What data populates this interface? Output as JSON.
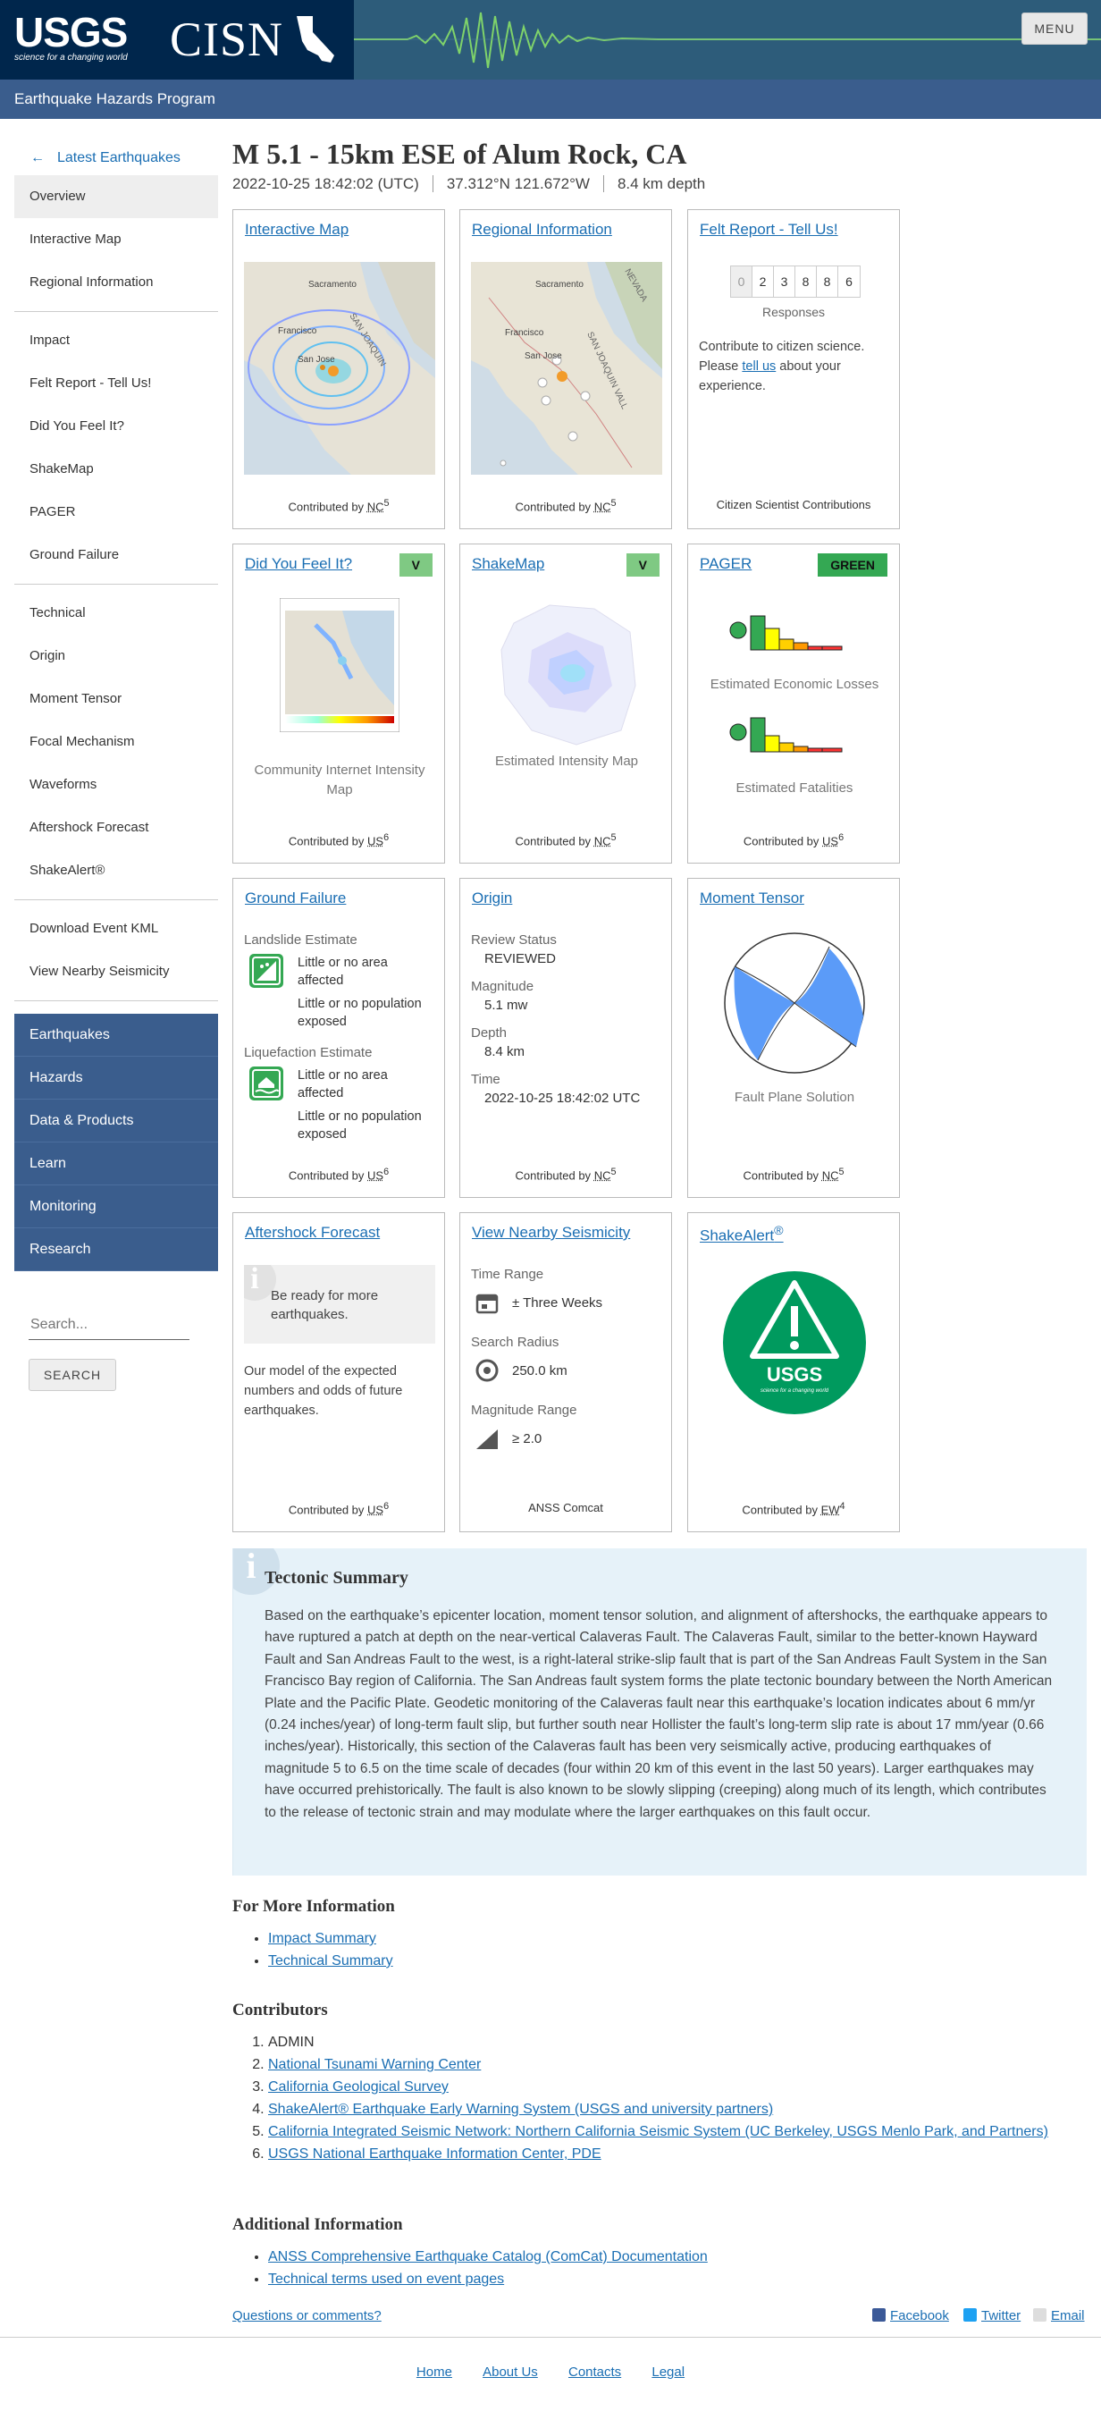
{
  "header": {
    "usgs_logo": "USGS",
    "usgs_tagline": "science for a changing world",
    "cisn_logo": "CISN",
    "menu_label": "MENU",
    "program": "Earthquake Hazards Program"
  },
  "sidebar": {
    "back_label": "Latest Earthquakes",
    "group1": [
      "Overview",
      "Interactive Map",
      "Regional Information"
    ],
    "group2": [
      "Impact",
      "Felt Report - Tell Us!",
      "Did You Feel It?",
      "ShakeMap",
      "PAGER",
      "Ground Failure"
    ],
    "group3": [
      "Technical",
      "Origin",
      "Moment Tensor",
      "Focal Mechanism",
      "Waveforms",
      "Aftershock Forecast",
      "ShakeAlert®"
    ],
    "group4": [
      "Download Event KML",
      "View Nearby Seismicity"
    ],
    "blue": [
      "Earthquakes",
      "Hazards",
      "Data & Products",
      "Learn",
      "Monitoring",
      "Research"
    ],
    "search_placeholder": "Search...",
    "search_button": "SEARCH"
  },
  "event": {
    "title": "M 5.1 - 15km ESE of Alum Rock, CA",
    "time": "2022-10-25 18:42:02 (UTC)",
    "location": "37.312°N 121.672°W",
    "depth": "8.4 km depth"
  },
  "cards": {
    "interactive_map": {
      "title": "Interactive Map",
      "contrib": "Contributed by",
      "net": "NC",
      "sup": "5",
      "labels": [
        "Sacramento",
        "Francisco",
        "San Jose",
        "SAN JOAQUIN"
      ]
    },
    "regional": {
      "title": "Regional Information",
      "contrib": "Contributed by",
      "net": "NC",
      "sup": "5",
      "labels": [
        "Sacramento",
        "Francisco",
        "San Jose",
        "SAN JOAQUIN VALL",
        "NEVADA"
      ]
    },
    "felt": {
      "title": "Felt Report - Tell Us!",
      "counts": [
        "0",
        "2",
        "3",
        "8",
        "8",
        "6"
      ],
      "responses": "Responses",
      "text1": "Contribute to citizen science. Please",
      "link": "tell us",
      "text2": "about your experience.",
      "footer": "Citizen Scientist Contributions"
    },
    "dyfi": {
      "title": "Did You Feel It?",
      "badge": "V",
      "caption": "Community Internet Intensity Map",
      "contrib": "Contributed by",
      "net": "US",
      "sup": "6"
    },
    "shakemap": {
      "title": "ShakeMap",
      "badge": "V",
      "caption": "Estimated Intensity Map",
      "contrib": "Contributed by",
      "net": "NC",
      "sup": "5"
    },
    "pager": {
      "title": "PAGER",
      "badge": "GREEN",
      "caption1": "Estimated Economic Losses",
      "caption2": "Estimated Fatalities",
      "contrib": "Contributed by",
      "net": "US",
      "sup": "6"
    },
    "ground_failure": {
      "title": "Ground Failure",
      "landslide": "Landslide Estimate",
      "liquefaction": "Liquefaction Estimate",
      "area": "Little or no area affected",
      "pop": "Little or no population exposed",
      "contrib": "Contributed by",
      "net": "US",
      "sup": "6"
    },
    "origin": {
      "title": "Origin",
      "review_label": "Review Status",
      "review": "REVIEWED",
      "mag_label": "Magnitude",
      "mag": "5.1 mw",
      "depth_label": "Depth",
      "depth": "8.4 km",
      "time_label": "Time",
      "time": "2022-10-25 18:42:02 UTC",
      "contrib": "Contributed by",
      "net": "NC",
      "sup": "5"
    },
    "moment_tensor": {
      "title": "Moment Tensor",
      "caption": "Fault Plane Solution",
      "contrib": "Contributed by",
      "net": "NC",
      "sup": "5"
    },
    "aftershock": {
      "title": "Aftershock Forecast",
      "box": "Be ready for more earthquakes.",
      "text": "Our model of the expected numbers and odds of future earthquakes.",
      "contrib": "Contributed by",
      "net": "US",
      "sup": "6"
    },
    "nearby": {
      "title": "View Nearby Seismicity",
      "time_label": "Time Range",
      "time": "± Three Weeks",
      "radius_label": "Search Radius",
      "radius": "250.0 km",
      "mag_label": "Magnitude Range",
      "mag": "≥ 2.0",
      "footer": "ANSS Comcat"
    },
    "shakealert": {
      "title": "ShakeAlert",
      "title_sup": "®",
      "logo": "USGS",
      "logo_tag": "science for a changing world",
      "contrib": "Contributed by",
      "net": "EW",
      "sup": "4"
    }
  },
  "tectonic": {
    "title": "Tectonic Summary",
    "body": "Based on the earthquake’s epicenter location, moment tensor solution, and alignment of aftershocks, the earthquake appears to have ruptured a patch at depth on the near-vertical Calaveras Fault. The Calaveras Fault, similar to the better-known Hayward Fault and San Andreas Fault to the west, is a right-lateral strike-slip fault that is part of the San Andreas Fault System in the San Francisco Bay region of California. The San Andreas fault system forms the plate tectonic boundary between the North American Plate and the Pacific Plate. Geodetic monitoring of the Calaveras fault near this earthquake’s location indicates about 6 mm/yr (0.24 inches/year) of long-term fault slip, but further south near Hollister the fault’s long-term slip rate is about 17 mm/year (0.66 inches/year). Historically, this section of the Calaveras fault has been very seismically active, producing earthquakes of magnitude 5 to 6.5 on the time scale of decades (four within 20 km of this event in the last 50 years). Larger earthquakes may have occurred prehistorically. The fault is also known to be slowly slipping (creeping) along much of its length, which contributes to the release of tectonic strain and may modulate where the larger earthquakes on this fault occur."
  },
  "more_info": {
    "title": "For More Information",
    "links": [
      "Impact Summary",
      "Technical Summary"
    ]
  },
  "contributors": {
    "title": "Contributors",
    "items": [
      "ADMIN",
      "National Tsunami Warning Center",
      "California Geological Survey",
      "ShakeAlert® Earthquake Early Warning System (USGS and university partners)",
      "California Integrated Seismic Network: Northern California Seismic System (UC Berkeley, USGS Menlo Park, and Partners)",
      "USGS National Earthquake Information Center, PDE"
    ]
  },
  "additional": {
    "title": "Additional Information",
    "links": [
      "ANSS Comprehensive Earthquake Catalog (ComCat) Documentation",
      "Technical terms used on event pages"
    ]
  },
  "bottom": {
    "questions": "Questions or comments?",
    "facebook": "Facebook",
    "twitter": "Twitter",
    "email": "Email"
  },
  "footer": {
    "links": [
      "Home",
      "About Us",
      "Contacts",
      "Legal"
    ]
  },
  "colors": {
    "navy": "#00264c",
    "blue": "#3a5d8d",
    "link": "#1a6eb3",
    "badge_v": "#7fc983",
    "badge_green": "#34a853",
    "tectonic_bg": "#e6f2f9"
  }
}
